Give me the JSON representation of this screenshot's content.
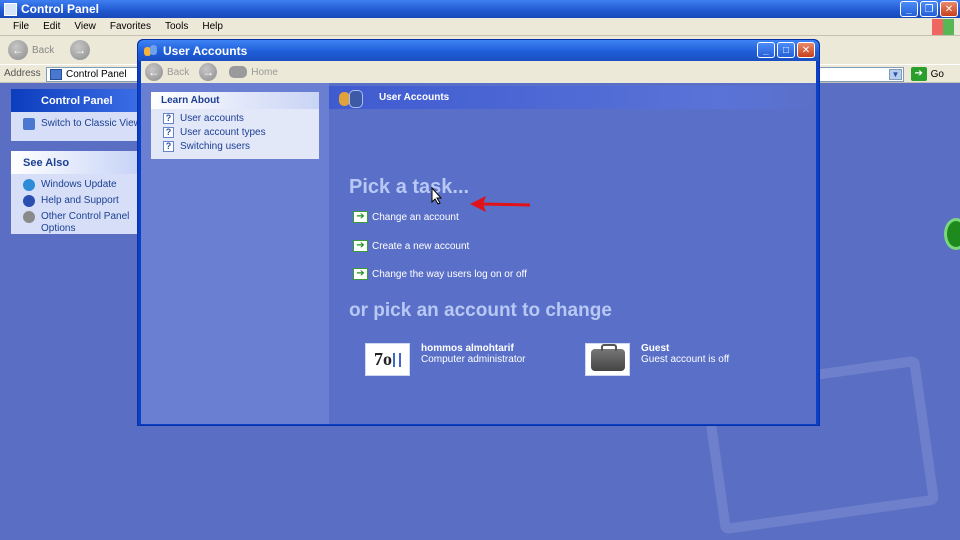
{
  "bg_window": {
    "title": "Control Panel",
    "menu": [
      "File",
      "Edit",
      "View",
      "Favorites",
      "Tools",
      "Help"
    ],
    "toolbar": {
      "back_label": "Back"
    },
    "address": {
      "label": "Address",
      "value": "Control Panel",
      "go_label": "Go"
    },
    "sidebar": {
      "control_panel": {
        "title": "Control Panel",
        "switch_label": "Switch to Classic View"
      },
      "see_also": {
        "title": "See Also",
        "items": [
          "Windows Update",
          "Help and Support",
          "Other Control Panel Options"
        ]
      }
    }
  },
  "ua_window": {
    "title": "User Accounts",
    "toolbar": {
      "back_label": "Back",
      "home_label": "Home"
    },
    "learn_about": {
      "title": "Learn About",
      "items": [
        "User accounts",
        "User account types",
        "Switching users"
      ]
    },
    "header": "User Accounts",
    "pick_task": "Pick a task...",
    "tasks": [
      "Change an account",
      "Create a new account",
      "Change the way users log on or off"
    ],
    "or_pick": "or pick an account to change",
    "accounts": [
      {
        "picture_text": "7o",
        "name": "hommos almohtarif",
        "type": "Computer administrator"
      },
      {
        "name": "Guest",
        "type": "Guest account is off"
      }
    ]
  },
  "colors": {
    "arrow": "#e0121a",
    "xp_blue": "#0a3fc8",
    "task_green": "#1f8e1f"
  }
}
